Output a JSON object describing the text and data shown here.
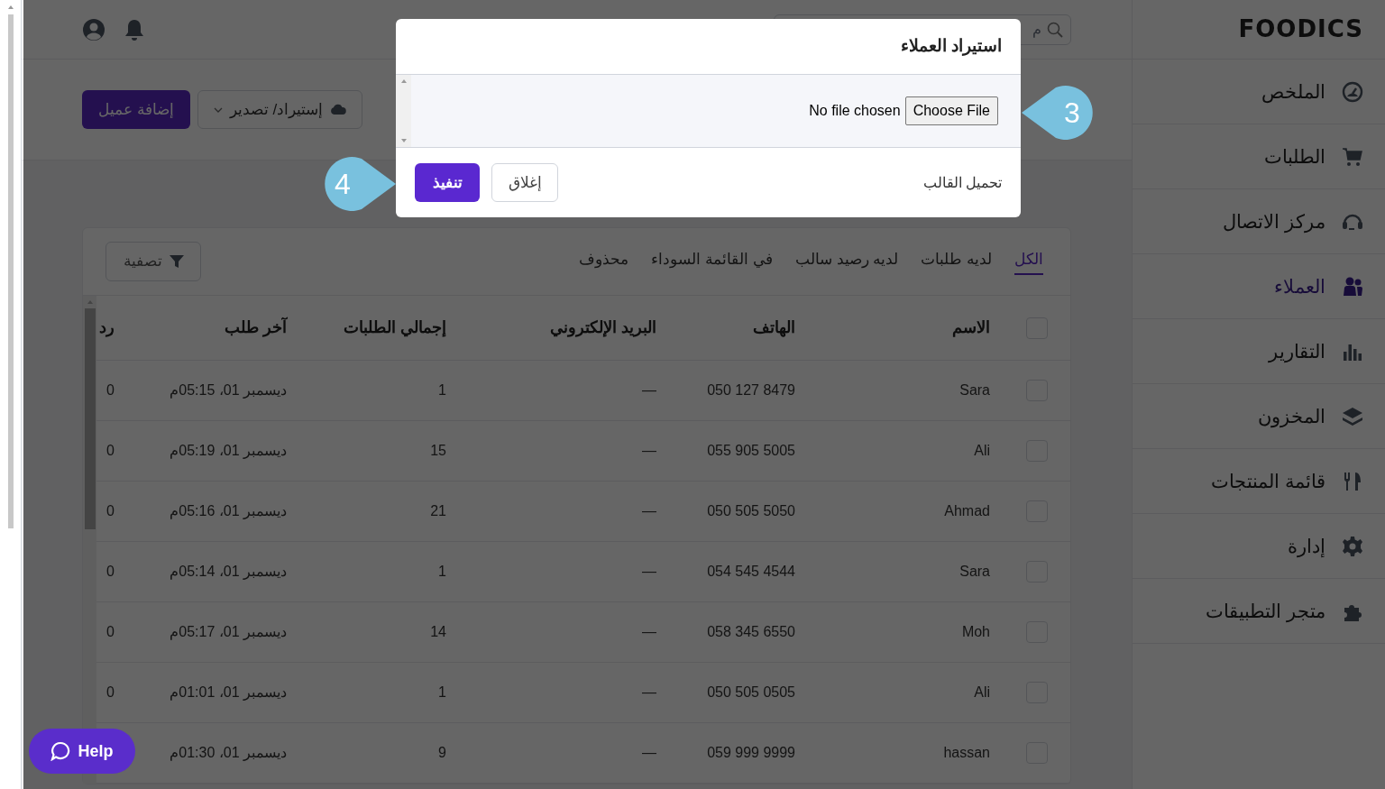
{
  "header": {
    "search": {
      "placeholder": "م"
    }
  },
  "actions": {
    "import_export": "إستيراد/ تصدير",
    "add_customer": "إضافة عميل"
  },
  "sidebar": {
    "logo": "FOODICS",
    "items": [
      {
        "label": "الملخص",
        "selected": false
      },
      {
        "label": "الطلبات",
        "selected": false
      },
      {
        "label": "مركز الاتصال",
        "selected": false
      },
      {
        "label": "العملاء",
        "selected": true
      },
      {
        "label": "التقارير",
        "selected": false
      },
      {
        "label": "المخزون",
        "selected": false
      },
      {
        "label": "قائمة المنتجات",
        "selected": false
      },
      {
        "label": "إدارة",
        "selected": false
      },
      {
        "label": "متجر التطبيقات",
        "selected": false
      }
    ]
  },
  "tabs": [
    {
      "label": "الكل",
      "selected": true
    },
    {
      "label": "لديه طلبات",
      "selected": false
    },
    {
      "label": "لديه رصيد سالب",
      "selected": false
    },
    {
      "label": "في القائمة السوداء",
      "selected": false
    },
    {
      "label": "محذوف",
      "selected": false
    }
  ],
  "filter_button": "تصفية",
  "table": {
    "header_checked": false,
    "columns": [
      "الاسم",
      "الهاتف",
      "البريد الإلكتروني",
      "إجمالي الطلبات",
      "آخر طلب",
      "رد"
    ],
    "rows": [
      {
        "checked": false,
        "name": "Sara",
        "phone": "050 127 8479",
        "email": "—",
        "total_orders": "1",
        "last_order": "ديسمبر 01، 05:15م",
        "column_6": "0"
      },
      {
        "checked": false,
        "name": "Ali",
        "phone": "055 905 5005",
        "email": "—",
        "total_orders": "15",
        "last_order": "ديسمبر 01، 05:19م",
        "column_6": "0"
      },
      {
        "checked": false,
        "name": "Ahmad",
        "phone": "050 505 5050",
        "email": "—",
        "total_orders": "21",
        "last_order": "ديسمبر 01، 05:16م",
        "column_6": "0"
      },
      {
        "checked": false,
        "name": "Sara",
        "phone": "054 545 4544",
        "email": "—",
        "total_orders": "1",
        "last_order": "ديسمبر 01، 05:14م",
        "column_6": "0"
      },
      {
        "checked": false,
        "name": "Moh",
        "phone": "058 345 6550",
        "email": "—",
        "total_orders": "14",
        "last_order": "ديسمبر 01، 05:17م",
        "column_6": "0"
      },
      {
        "checked": false,
        "name": "Ali",
        "phone": "050 505 0505",
        "email": "—",
        "total_orders": "1",
        "last_order": "ديسمبر 01، 01:01م",
        "column_6": "0"
      },
      {
        "checked": false,
        "name": "hassan",
        "phone": "059 999 9999",
        "email": "—",
        "total_orders": "9",
        "last_order": "ديسمبر 01، 01:30م"
      }
    ]
  },
  "modal": {
    "title": "استيراد العملاء",
    "file_button": "Choose File",
    "file_status": "No file chosen",
    "template_link": "تحميل القالب",
    "close_button": "إغلاق",
    "submit_button": "تنفيذ"
  },
  "callouts": [
    {
      "label": "3"
    },
    {
      "label": "4"
    }
  ],
  "help_button": "Help"
}
